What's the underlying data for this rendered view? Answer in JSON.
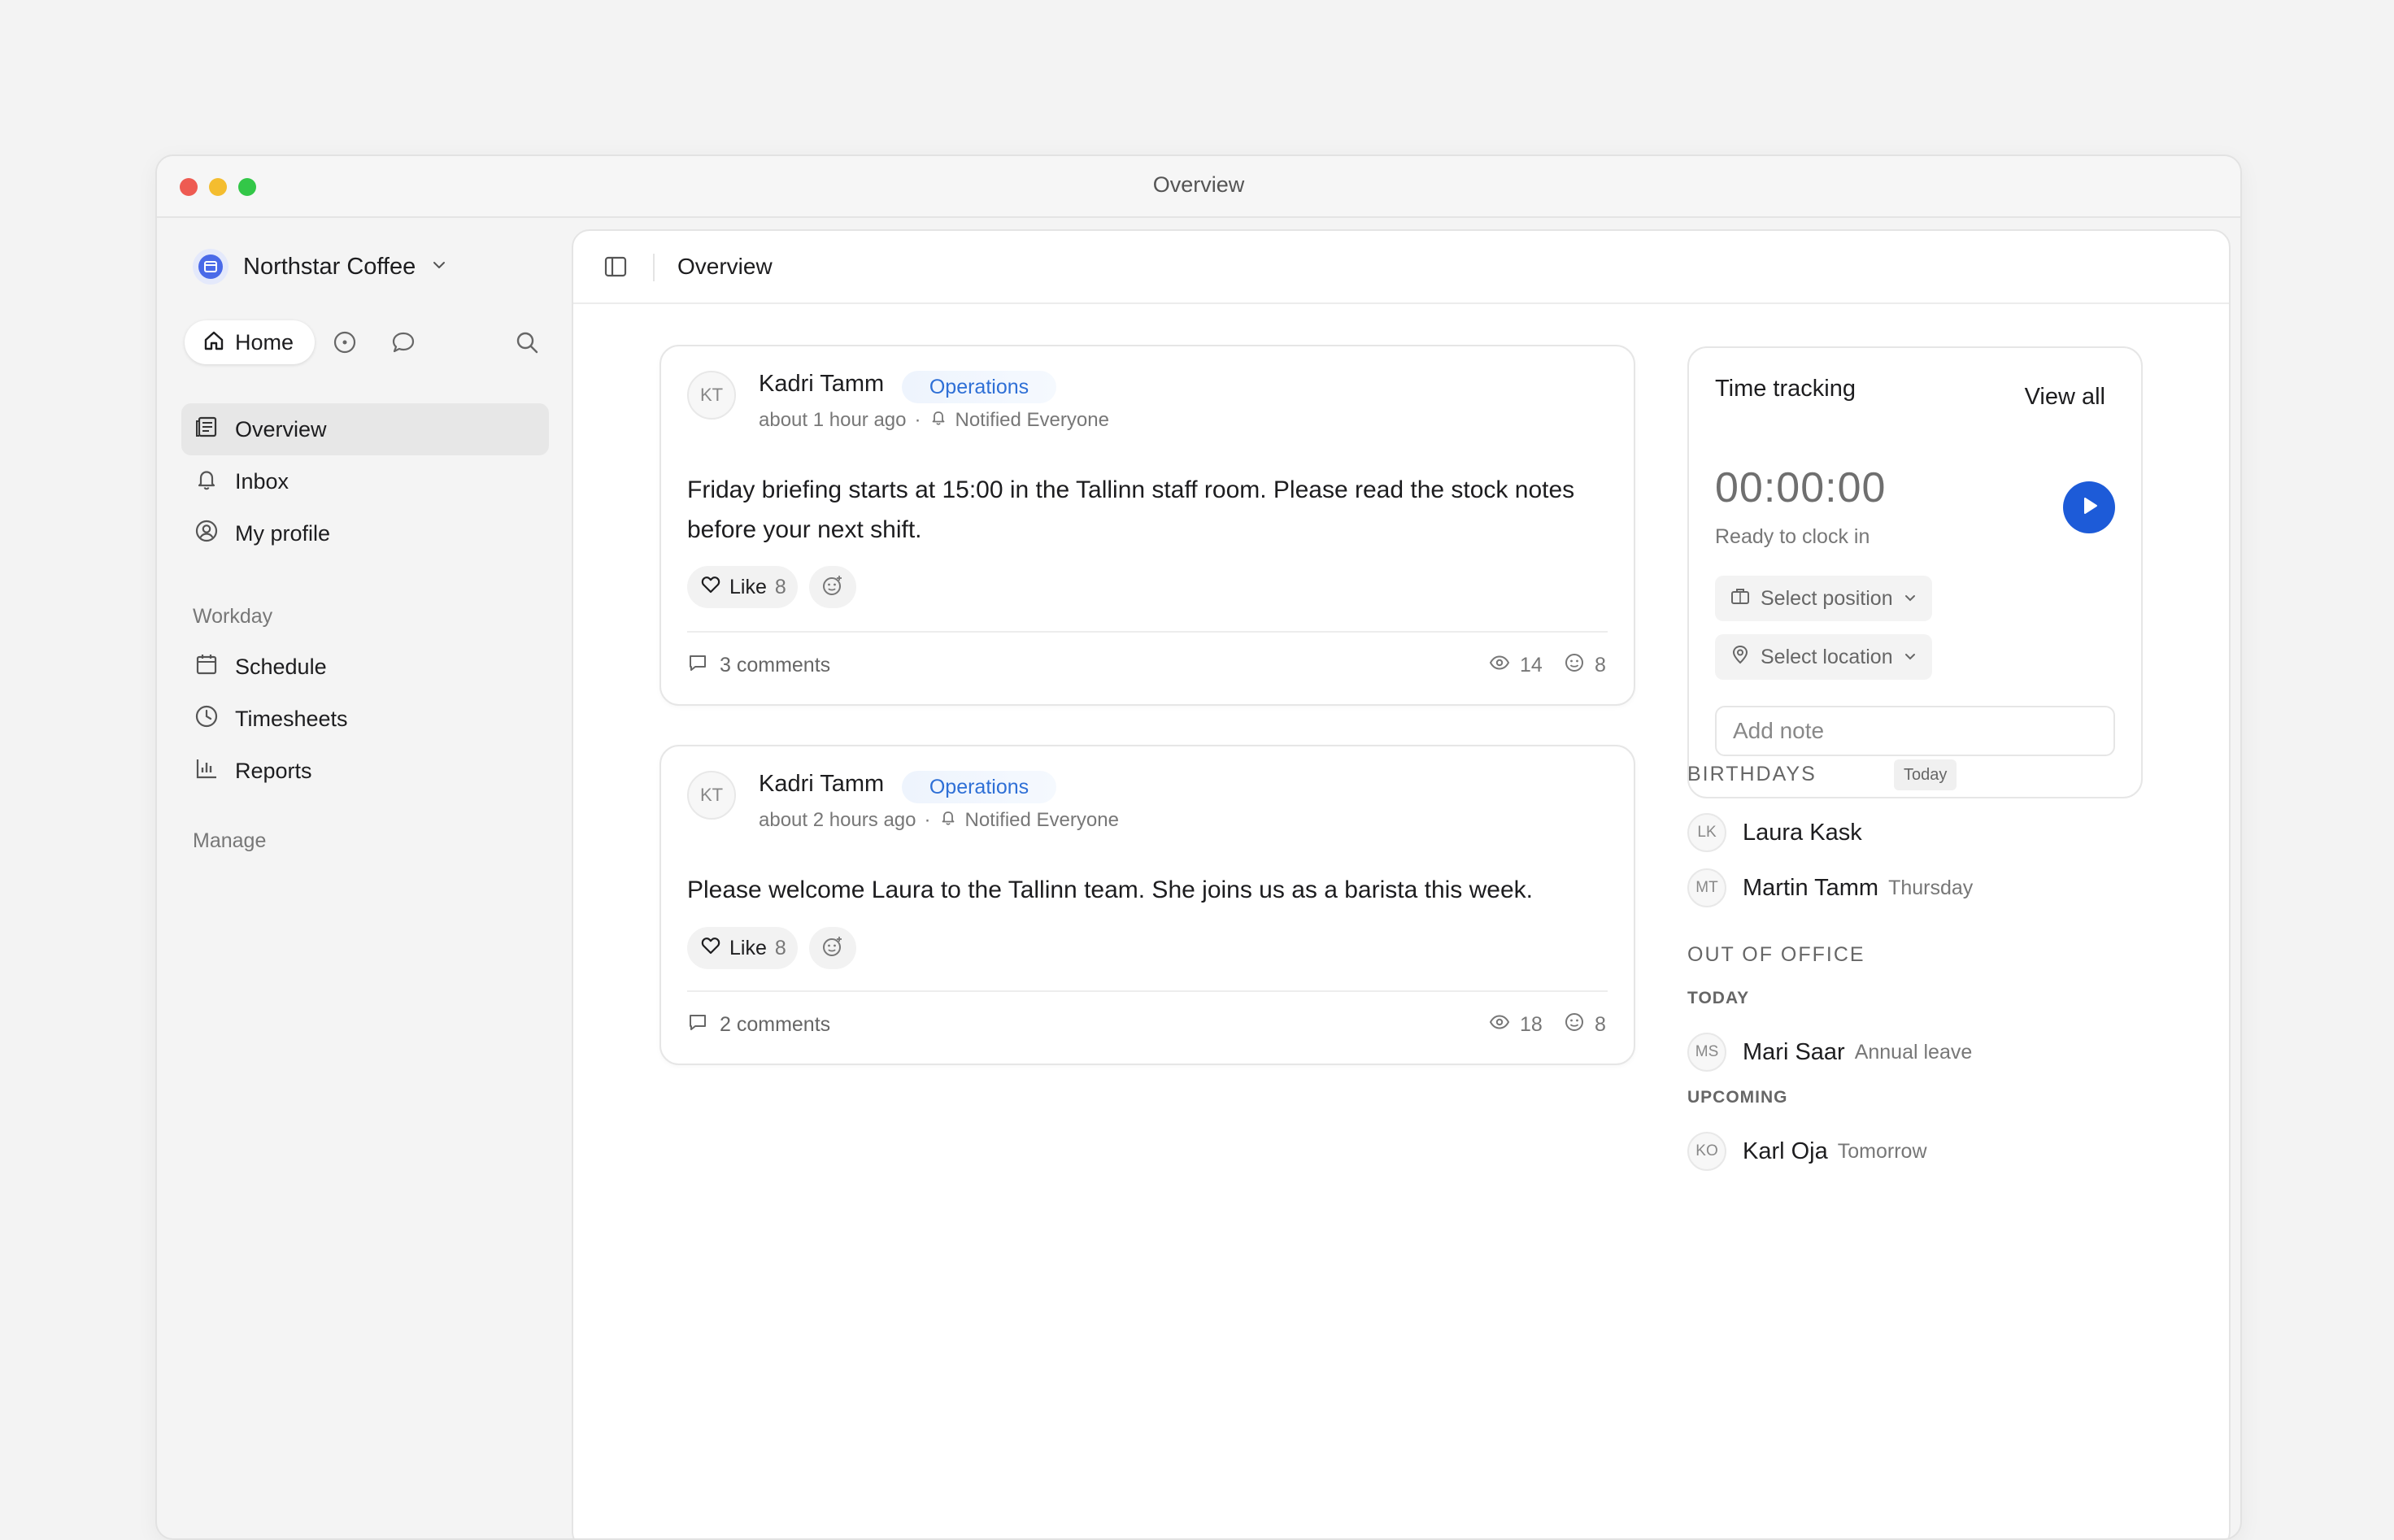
{
  "window": {
    "title": "Overview"
  },
  "sidebar": {
    "workspace": "Northstar Coffee",
    "home_label": "Home",
    "items": [
      {
        "label": "Overview",
        "icon": "overview-icon",
        "active": true
      },
      {
        "label": "Inbox",
        "icon": "bell-icon"
      },
      {
        "label": "My profile",
        "icon": "user-circle-icon"
      }
    ],
    "workday_label": "Workday",
    "workday_items": [
      {
        "label": "Schedule",
        "icon": "calendar-icon"
      },
      {
        "label": "Timesheets",
        "icon": "clock-icon"
      },
      {
        "label": "Reports",
        "icon": "bar-chart-icon"
      }
    ],
    "manage_label": "Manage"
  },
  "main": {
    "title": "Overview"
  },
  "posts": [
    {
      "initials": "KT",
      "author": "Kadri Tamm",
      "tag": "Operations",
      "time": "about 1 hour ago",
      "notified": "Notified Everyone",
      "body": "Friday briefing starts at 15:00 in the Tallinn staff room. Please read the stock notes before your next shift.",
      "like_label": "Like",
      "like_count": "8",
      "comments": "3 comments",
      "views": "14",
      "reactions": "8"
    },
    {
      "initials": "KT",
      "author": "Kadri Tamm",
      "tag": "Operations",
      "time": "about 2 hours ago",
      "notified": "Notified Everyone",
      "body": "Please welcome Laura to the Tallinn team. She joins us as a barista this week.",
      "like_label": "Like",
      "like_count": "8",
      "comments": "2 comments",
      "views": "18",
      "reactions": "8"
    }
  ],
  "time_tracking": {
    "title": "Time tracking",
    "view_all": "View all",
    "clock": "00:00:00",
    "status": "Ready to clock in",
    "select_position": "Select position",
    "select_location": "Select location",
    "note_placeholder": "Add note"
  },
  "birthdays": {
    "heading": "BIRTHDAYS",
    "badge": "Today",
    "people": [
      {
        "initials": "LK",
        "name": "Laura Kask",
        "note": ""
      },
      {
        "initials": "MT",
        "name": "Martin Tamm",
        "note": "Thursday"
      }
    ]
  },
  "out_of_office": {
    "heading": "OUT OF OFFICE",
    "today_label": "TODAY",
    "today": [
      {
        "initials": "MS",
        "name": "Mari Saar",
        "note": "Annual leave"
      }
    ],
    "upcoming_label": "UPCOMING",
    "upcoming": [
      {
        "initials": "KO",
        "name": "Karl Oja",
        "note": "Tomorrow"
      }
    ]
  },
  "colors": {
    "accent": "#1d5bd8",
    "tag_text": "#2e6fd6",
    "page_bg": "#f3f3f3"
  }
}
